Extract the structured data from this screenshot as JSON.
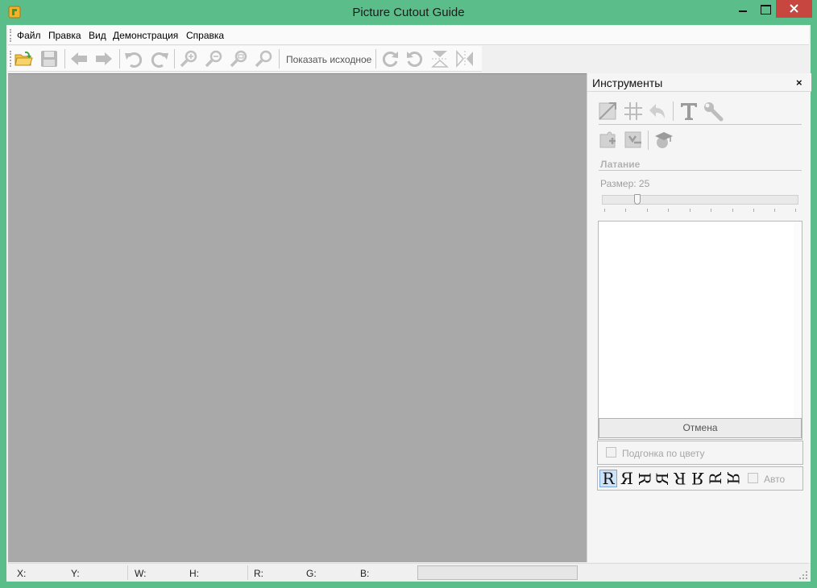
{
  "window": {
    "title": "Picture Cutout Guide"
  },
  "menu": [
    "Файл",
    "Правка",
    "Вид",
    "Демонстрация",
    "Справка"
  ],
  "toolbar": {
    "show_original": "Показать исходное",
    "icons": [
      "open-icon",
      "save-icon",
      "back-icon",
      "forward-icon",
      "undo-icon",
      "redo-icon",
      "zoom-in-icon",
      "zoom-out-icon",
      "zoom-fit-icon",
      "zoom-actual-icon",
      "rotate-cw-icon",
      "rotate-ccw-icon",
      "flip-vertical-icon",
      "flip-horizontal-icon"
    ]
  },
  "panel": {
    "title": "Инструменты",
    "close": "×",
    "section_title": "Латание",
    "size_label": "Размер: 25",
    "size_value": 25,
    "cancel_label": "Отмена",
    "color_fit_label": "Подгонка по цвету",
    "auto_label": "Авто",
    "orientations": [
      "R",
      "Я",
      "R",
      "R",
      "R",
      "Я",
      "R",
      "R"
    ]
  },
  "status": {
    "x": "X:",
    "y": "Y:",
    "w": "W:",
    "h": "H:",
    "r": "R:",
    "g": "G:",
    "b": "B:"
  },
  "colors": {
    "frame": "#5bbd8a",
    "canvas": "#a9a9a9",
    "close_button": "#c7463f",
    "selected": "#cfe3f7"
  }
}
